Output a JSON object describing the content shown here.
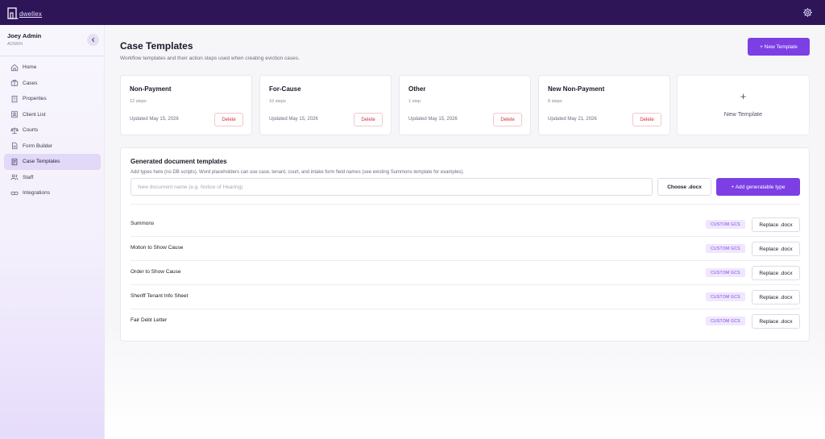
{
  "app": {
    "logo_text": "dwellex",
    "settings_icon": "gear-icon"
  },
  "user": {
    "name": "Joey Admin",
    "role": "ADMIN"
  },
  "sidebar": {
    "collapse_icon": "chevron-left-icon",
    "items": [
      {
        "label": "Home",
        "icon": "home-icon"
      },
      {
        "label": "Cases",
        "icon": "briefcase-icon"
      },
      {
        "label": "Properties",
        "icon": "building-icon"
      },
      {
        "label": "Client List",
        "icon": "address-book-icon"
      },
      {
        "label": "Courts",
        "icon": "scales-icon"
      },
      {
        "label": "Form Builder",
        "icon": "form-icon"
      },
      {
        "label": "Case Templates",
        "icon": "document-icon",
        "active": true
      },
      {
        "label": "Staff",
        "icon": "users-icon"
      },
      {
        "label": "Integrations",
        "icon": "link-icon"
      }
    ]
  },
  "page": {
    "title": "Case Templates",
    "subtitle": "Workflow templates and their action steps used when creating eviction cases.",
    "new_template_button": "+ New Template"
  },
  "templates": [
    {
      "name": "Non-Payment",
      "steps": "12 steps",
      "updated": "Updated May 15, 2026",
      "delete_label": "Delete"
    },
    {
      "name": "For-Cause",
      "steps": "10 steps",
      "updated": "Updated May 15, 2026",
      "delete_label": "Delete"
    },
    {
      "name": "Other",
      "steps": "1 step",
      "updated": "Updated May 15, 2026",
      "delete_label": "Delete"
    },
    {
      "name": "New Non-Payment",
      "steps": "8 steps",
      "updated": "Updated May 21, 2026",
      "delete_label": "Delete"
    }
  ],
  "new_card": {
    "plus": "+",
    "label": "New Template"
  },
  "generated": {
    "title": "Generated document templates",
    "description": "Add types here (no DB scripts). Word placeholders can use case, tenant, court, and intake form field names (see existing Summons template for examples).",
    "input_value": "",
    "input_placeholder": "New document name (e.g. Notice of Hearing)",
    "choose_label": "Choose .docx",
    "add_label": "+ Add generatable type",
    "rows": [
      {
        "name": "Summons",
        "badge": "CUSTOM GCS",
        "replace_label": "Replace .docx"
      },
      {
        "name": "Motion to Show Cause",
        "badge": "CUSTOM GCS",
        "replace_label": "Replace .docx"
      },
      {
        "name": "Order to Show Cause",
        "badge": "CUSTOM GCS",
        "replace_label": "Replace .docx"
      },
      {
        "name": "Sheriff Tenant Info Sheet",
        "badge": "CUSTOM GCS",
        "replace_label": "Replace .docx"
      },
      {
        "name": "Fair Debt Letter",
        "badge": "CUSTOM GCS",
        "replace_label": "Replace .docx"
      }
    ]
  },
  "colors": {
    "topbar": "#2d1558",
    "accent": "#7b3fe4",
    "danger": "#d6303d",
    "sidebar_active": "#e2d8f7"
  }
}
